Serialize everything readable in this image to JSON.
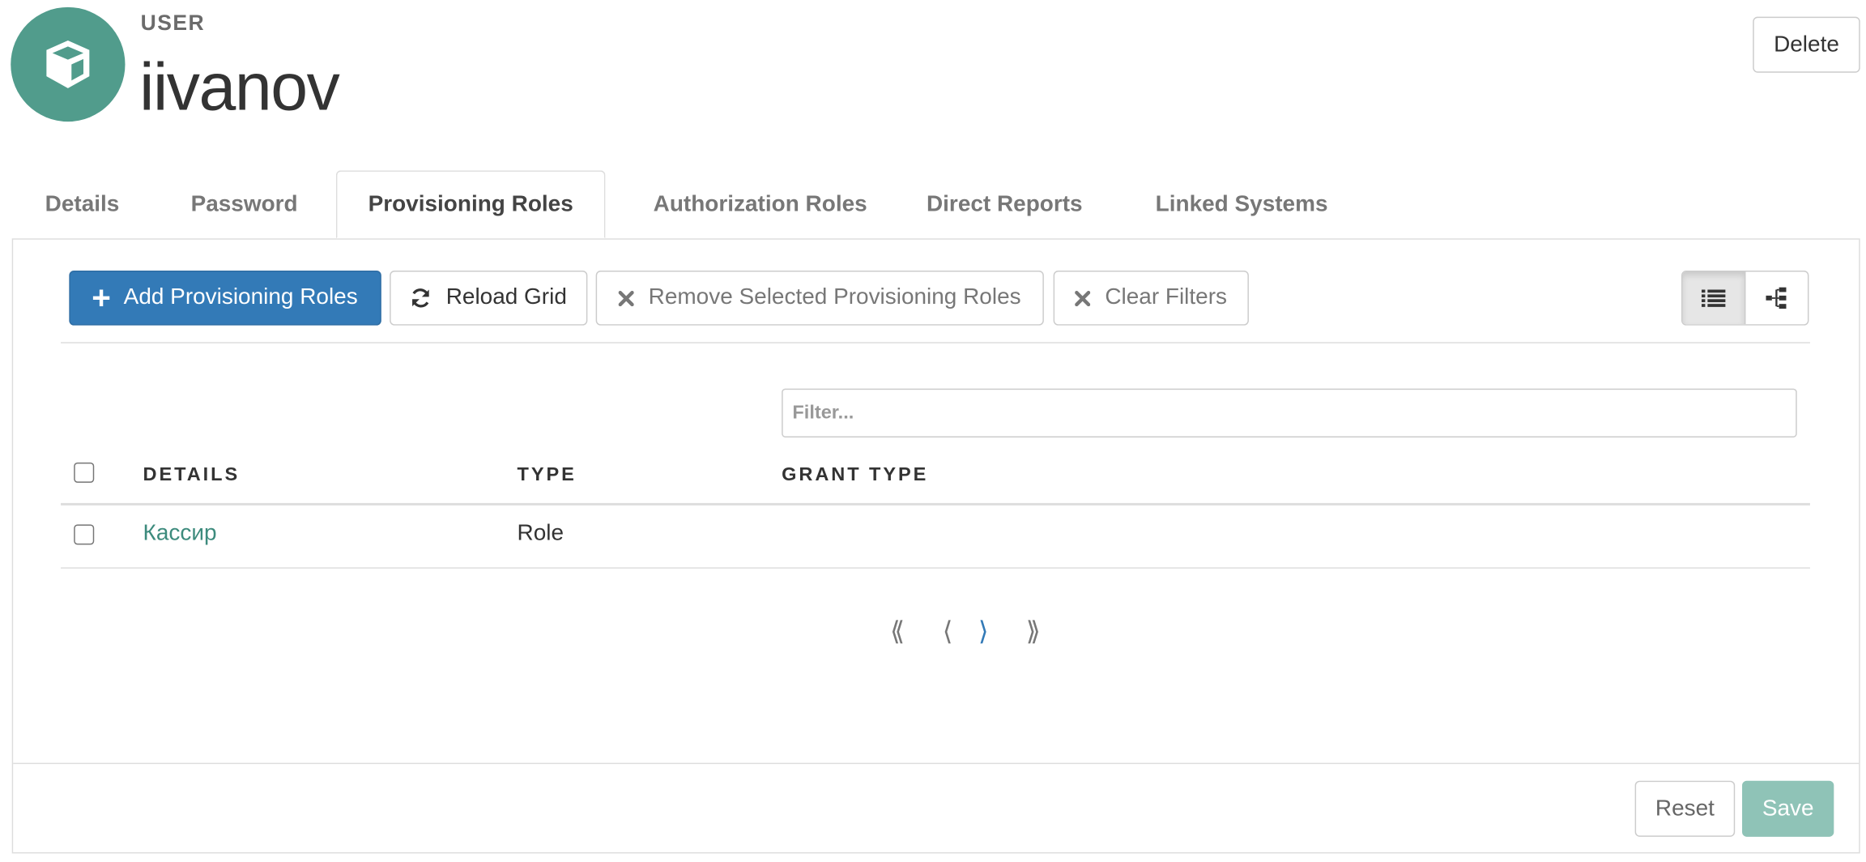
{
  "header": {
    "eyebrow": "USER",
    "username": "iivanov",
    "avatar_icon": "cube-icon",
    "delete_label": "Delete"
  },
  "tabs": [
    {
      "label": "Details",
      "active": false
    },
    {
      "label": "Password",
      "active": false
    },
    {
      "label": "Provisioning Roles",
      "active": true
    },
    {
      "label": "Authorization Roles",
      "active": false
    },
    {
      "label": "Direct Reports",
      "active": false
    },
    {
      "label": "Linked Systems",
      "active": false
    }
  ],
  "toolbar": {
    "add_label": "Add Provisioning Roles",
    "reload_label": "Reload Grid",
    "remove_label": "Remove Selected Provisioning Roles",
    "clear_label": "Clear Filters",
    "view_list_icon": "list-icon",
    "view_tree_icon": "tree-icon"
  },
  "filter": {
    "placeholder": "Filter..."
  },
  "table": {
    "columns": [
      "DETAILS",
      "TYPE",
      "GRANT TYPE"
    ],
    "rows": [
      {
        "details": "Кассир",
        "type": "Role",
        "grant_type": ""
      }
    ]
  },
  "pagination": {
    "first": "⟪",
    "prev": "⟨",
    "next": "⟩",
    "last": "⟫"
  },
  "footer": {
    "reset_label": "Reset",
    "save_label": "Save"
  },
  "colors": {
    "accent": "#519c8c",
    "primary": "#337ab7",
    "link": "#3d8b7d"
  }
}
